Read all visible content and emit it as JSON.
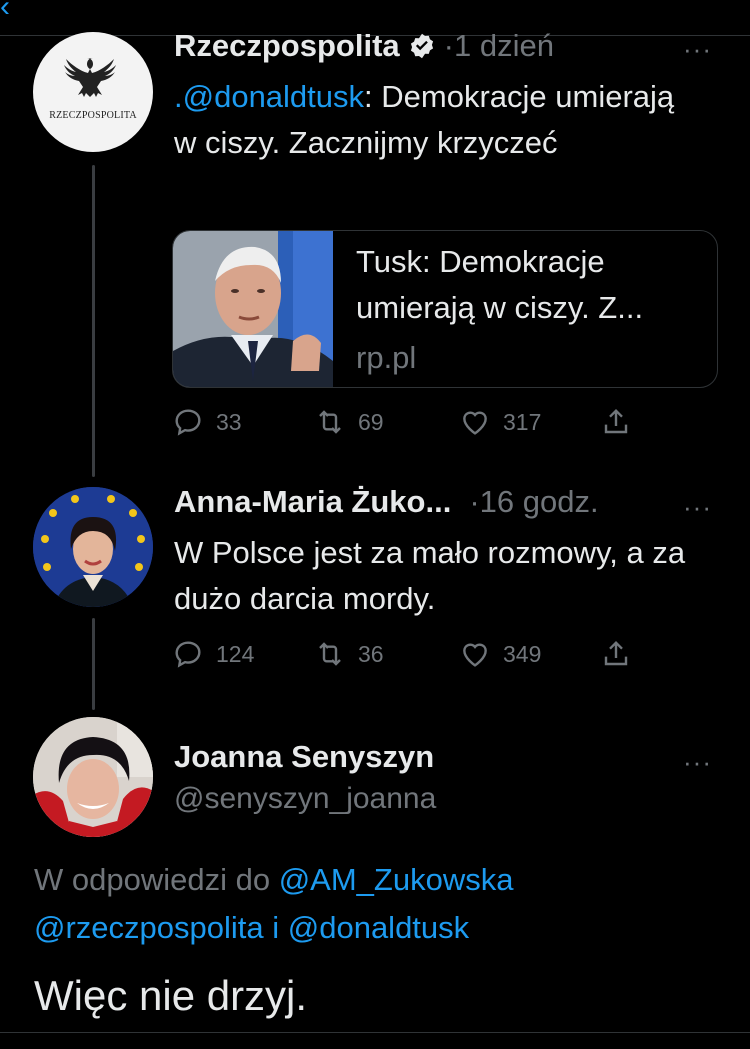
{
  "header": {
    "back_icon": "chevron-left-icon"
  },
  "colors": {
    "background": "#000000",
    "text": "#e7e9ea",
    "muted": "#71767b",
    "link": "#1d9bf0",
    "verified": "#e7e9ea"
  },
  "tweets": [
    {
      "name": "Rzeczpospolita",
      "verified": true,
      "time": "·1 dzień",
      "avatar_text": "RZECZPOSPOLITA",
      "text_mention": ".@donaldtusk",
      "text_rest": ": Demokracje umierają w ciszy. Zacznijmy krzyczeć",
      "card": {
        "title": "Tusk: Demokracje umierają w ciszy. Z...",
        "domain": "rp.pl"
      },
      "replies": "33",
      "retweets": "69",
      "likes": "317"
    },
    {
      "name": "Anna-Maria Żuko...",
      "time": "·16 godz.",
      "text": "W Polsce jest za mało rozmowy, a za dużo darcia mordy.",
      "replies": "124",
      "retweets": "36",
      "likes": "349"
    }
  ],
  "main": {
    "name": "Joanna Senyszyn",
    "handle": "@senyszyn_joanna",
    "reply_prefix": "W odpowiedzi do ",
    "reply_m1": "@AM_Zukowska",
    "reply_m2": "@rzeczpospolita",
    "reply_and": " i ",
    "reply_m3": "@donaldtusk",
    "text": "Więc nie drzyj."
  },
  "more_label": "···"
}
